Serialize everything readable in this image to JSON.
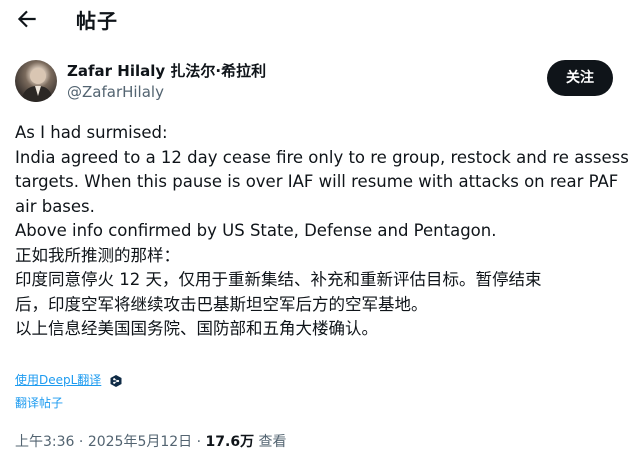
{
  "header": {
    "title": "帖子"
  },
  "author": {
    "display_name": "Zafar Hilaly 扎法尔·希拉利",
    "handle": "@ZafarHilaly",
    "follow_label": "关注"
  },
  "tweet": {
    "lines": [
      "As I had surmised:",
      "India agreed to a 12 day cease fire only to re group, restock and re assess",
      "targets. When this pause is over IAF will resume with attacks on rear PAF",
      "air bases.",
      "Above info confirmed by US State, Defense and Pentagon.",
      "正如我所推测的那样：",
      "印度同意停火 12 天，仅用于重新集结、补充和重新评估目标。暂停结束",
      "后，印度空军将继续攻击巴基斯坦空军后方的空军基地。",
      "以上信息经美国国务院、国防部和五角大楼确认。"
    ]
  },
  "translation": {
    "with_label": "使用DeepL翻译",
    "translate_post_label": "翻译帖子"
  },
  "meta": {
    "time": "上午3:36",
    "separator": "·",
    "date": "2025年5月12日",
    "views_count": "17.6万",
    "views_label": "查看"
  },
  "icons": {
    "back": "arrow-left-icon",
    "deepl": "deepl-logo-icon"
  },
  "colors": {
    "link": "#1d9bf0",
    "text": "#0f1419",
    "secondary": "#536471",
    "follow_bg": "#0f1419"
  }
}
